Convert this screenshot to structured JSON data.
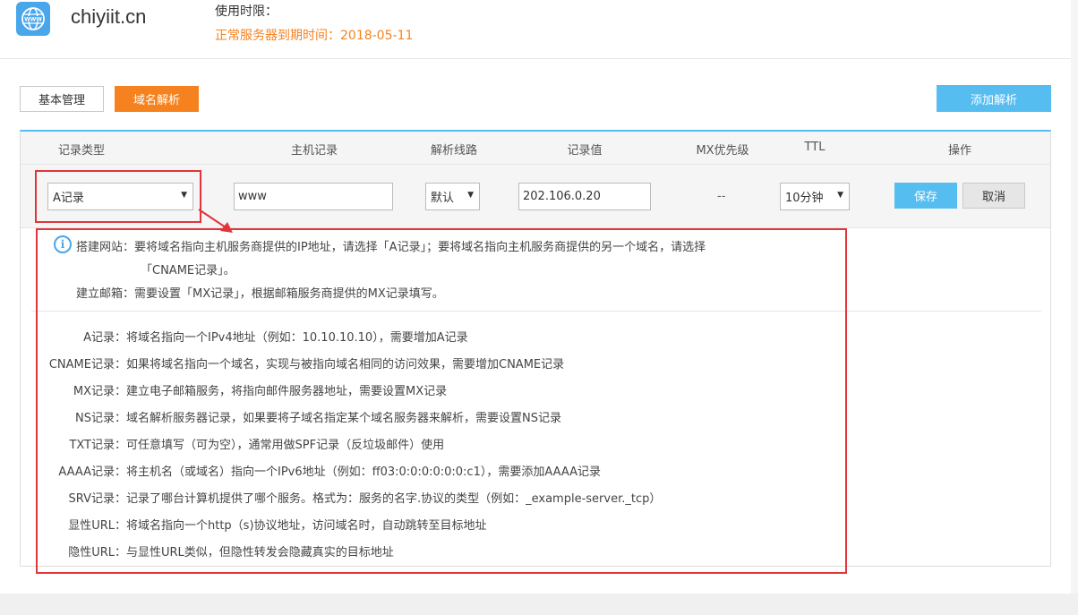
{
  "header": {
    "site_name": "chiyiit.cn",
    "usage_label": "使用时限：",
    "usage_expiry": "正常服务器到期时间：2018-05-11"
  },
  "toolbar": {
    "basic_manage": "基本管理",
    "domain_resolve": "域名解析",
    "add_resolve": "添加解析"
  },
  "table": {
    "headers": [
      "记录类型",
      "主机记录",
      "解析线路",
      "记录值",
      "MX优先级",
      "TTL",
      "操作"
    ],
    "edit_row": {
      "record_type": "A记录",
      "host": "www",
      "line": "默认",
      "value": "202.106.0.20",
      "mx": "--",
      "ttl": "10分钟",
      "save": "保存",
      "cancel": "取消"
    }
  },
  "help": {
    "site_tip_1": "搭建网站：要将域名指向主机服务商提供的IP地址，请选择「A记录」；要将域名指向主机服务商提供的另一个域名，请选择",
    "site_tip_2": "「CNAME记录」。",
    "mail_tip": "建立邮箱：需要设置「MX记录」，根据邮箱服务商提供的MX记录填写。",
    "records": [
      {
        "label": "A记录：",
        "desc": "将域名指向一个IPv4地址（例如：10.10.10.10），需要增加A记录"
      },
      {
        "label": "CNAME记录：",
        "desc": "如果将域名指向一个域名，实现与被指向域名相同的访问效果，需要增加CNAME记录"
      },
      {
        "label": "MX记录：",
        "desc": "建立电子邮箱服务，将指向邮件服务器地址，需要设置MX记录"
      },
      {
        "label": "NS记录：",
        "desc": "域名解析服务器记录，如果要将子域名指定某个域名服务器来解析，需要设置NS记录"
      },
      {
        "label": "TXT记录：",
        "desc": "可任意填写（可为空），通常用做SPF记录（反垃圾邮件）使用"
      },
      {
        "label": "AAAA记录：",
        "desc": "将主机名（或域名）指向一个IPv6地址（例如：ff03:0:0:0:0:0:0:c1），需要添加AAAA记录"
      },
      {
        "label": "SRV记录：",
        "desc": "记录了哪台计算机提供了哪个服务。格式为：服务的名字.协议的类型（例如：_example-server._tcp）"
      },
      {
        "label": "显性URL：",
        "desc": "将域名指向一个http（s)协议地址，访问域名时，自动跳转至目标地址"
      },
      {
        "label": "隐性URL：",
        "desc": "与显性URL类似，但隐性转发会隐藏真实的目标地址"
      }
    ]
  },
  "icons": {
    "site": "globe-www-icon",
    "info": "info-icon",
    "caret": "caret-down-icon"
  },
  "colors": {
    "accent_orange": "#f5821f",
    "accent_blue": "#56bdf0",
    "highlight_red": "#e0353b"
  }
}
